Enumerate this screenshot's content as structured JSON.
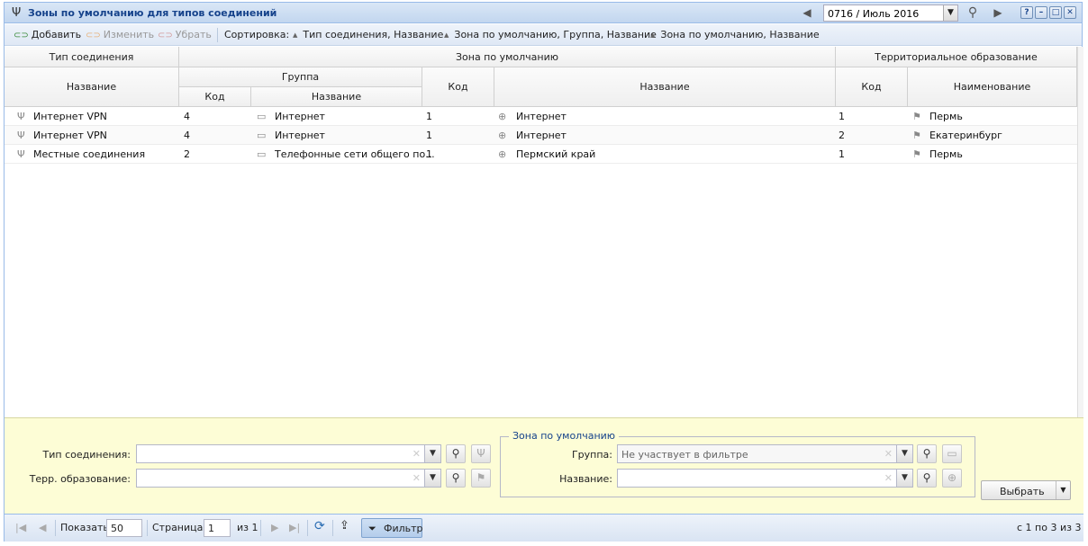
{
  "title": "Зоны по умолчанию для типов соединений",
  "period": "0716 / Июль 2016",
  "toolbar": {
    "add": "Добавить",
    "edit": "Изменить",
    "remove": "Убрать",
    "sort_label": "Сортировка:",
    "sort1": "Тип соединения, Название",
    "sort2": "Зона по умолчанию, Группа, Название",
    "sort3": "Зона по умолчанию, Название"
  },
  "columns": {
    "conn_type": "Тип соединения",
    "default_zone": "Зона по умолчанию",
    "territory": "Территориальное образование",
    "name": "Название",
    "group": "Группа",
    "code": "Код",
    "naming": "Наименование"
  },
  "rows": [
    {
      "conn_name": "Интернет VPN",
      "group_code": "4",
      "group_name": "Интернет",
      "zone_code": "1",
      "zone_name": "Интернет",
      "terr_code": "1",
      "terr_name": "Пермь"
    },
    {
      "conn_name": "Интернет VPN",
      "group_code": "4",
      "group_name": "Интернет",
      "zone_code": "1",
      "zone_name": "Интернет",
      "terr_code": "2",
      "terr_name": "Екатеринбург"
    },
    {
      "conn_name": "Местные соединения",
      "group_code": "2",
      "group_name": "Телефонные сети общего по...",
      "zone_code": "1",
      "zone_name": "Пермский край",
      "terr_code": "1",
      "terr_name": "Пермь"
    }
  ],
  "filter": {
    "conn_type_label": "Тип соединения:",
    "terr_label": "Терр. образование:",
    "zone_legend": "Зона по умолчанию",
    "group_label": "Группа:",
    "group_value": "Не участвует в фильтре",
    "name_label": "Название:",
    "select_button": "Выбрать"
  },
  "pager": {
    "show_label": "Показать",
    "page_size": "50",
    "page_label": "Страница",
    "page": "1",
    "of_label": "из 1",
    "filter_button": "Фильтр",
    "summary": "с 1 по 3 из 3"
  }
}
